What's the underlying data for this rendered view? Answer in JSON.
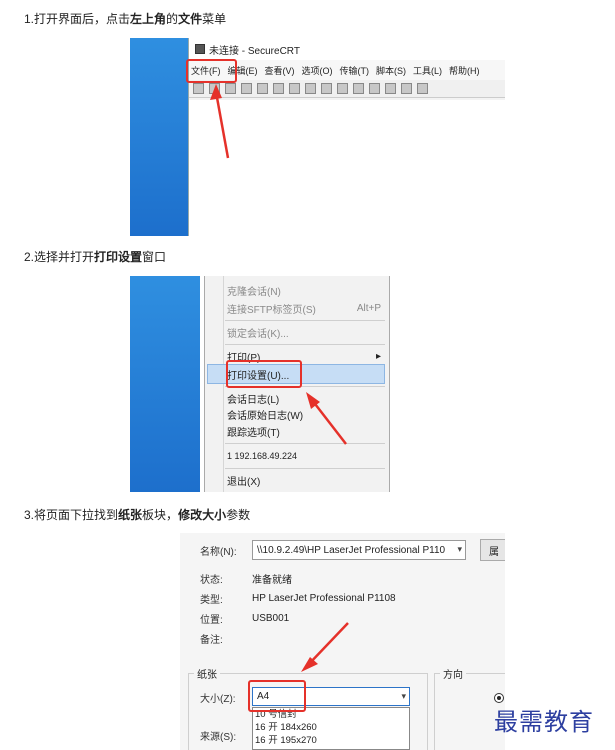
{
  "steps": [
    {
      "num": "1.",
      "pre": "打开界面后，点击",
      "b1": "左上角",
      "mid": "的",
      "b2": "文件",
      "post": "菜单"
    },
    {
      "num": "2.",
      "pre": "选择并打开",
      "b1": "打印设置",
      "post": "窗口"
    },
    {
      "num": "3.",
      "pre": "将页面下拉找到",
      "b1": "纸张",
      "mid": "板块，",
      "b2": "修改大小",
      "post": "参数"
    }
  ],
  "shot1": {
    "window_title": "未连接 - SecureCRT",
    "menu": [
      "文件(F)",
      "编辑(E)",
      "查看(V)",
      "选项(O)",
      "传输(T)",
      "脚本(S)",
      "工具(L)",
      "帮助(H)"
    ]
  },
  "shot2": {
    "items": {
      "clone": "克隆会话(N)",
      "sftp": "连接SFTP标签页(S)",
      "sftp_shortcut": "Alt+P",
      "lock": "锁定会话(K)...",
      "print": "打印(P)",
      "print_arrow": "▸",
      "print_setup": "打印设置(U)...",
      "log": "会话日志(L)",
      "raw_log": "会话原始日志(W)",
      "trace": "跟踪选项(T)",
      "recent": "1 192.168.49.224",
      "exit": "退出(X)"
    }
  },
  "shot3": {
    "name_label": "名称(N):",
    "printer": "\\\\10.9.2.49\\HP LaserJet Professional P110",
    "prop_btn": "属",
    "status_label": "状态:",
    "status_value": "准备就绪",
    "type_label": "类型:",
    "type_value": "HP LaserJet Professional P1108",
    "where_label": "位置:",
    "where_value": "USB001",
    "comment_label": "备注:",
    "paper_label": "纸张",
    "orientation_label": "方向",
    "size_label": "大小(Z):",
    "size_value": "A4",
    "source_label": "来源(S):",
    "options": [
      "10 号信封",
      "16 开 184x260",
      "16 开 195x270"
    ]
  },
  "watermark": "最需教育",
  "colors": {
    "highlight_red": "#e5312a",
    "accent_blue": "#2d74c8",
    "menu_hover": "#c6ddf5"
  }
}
